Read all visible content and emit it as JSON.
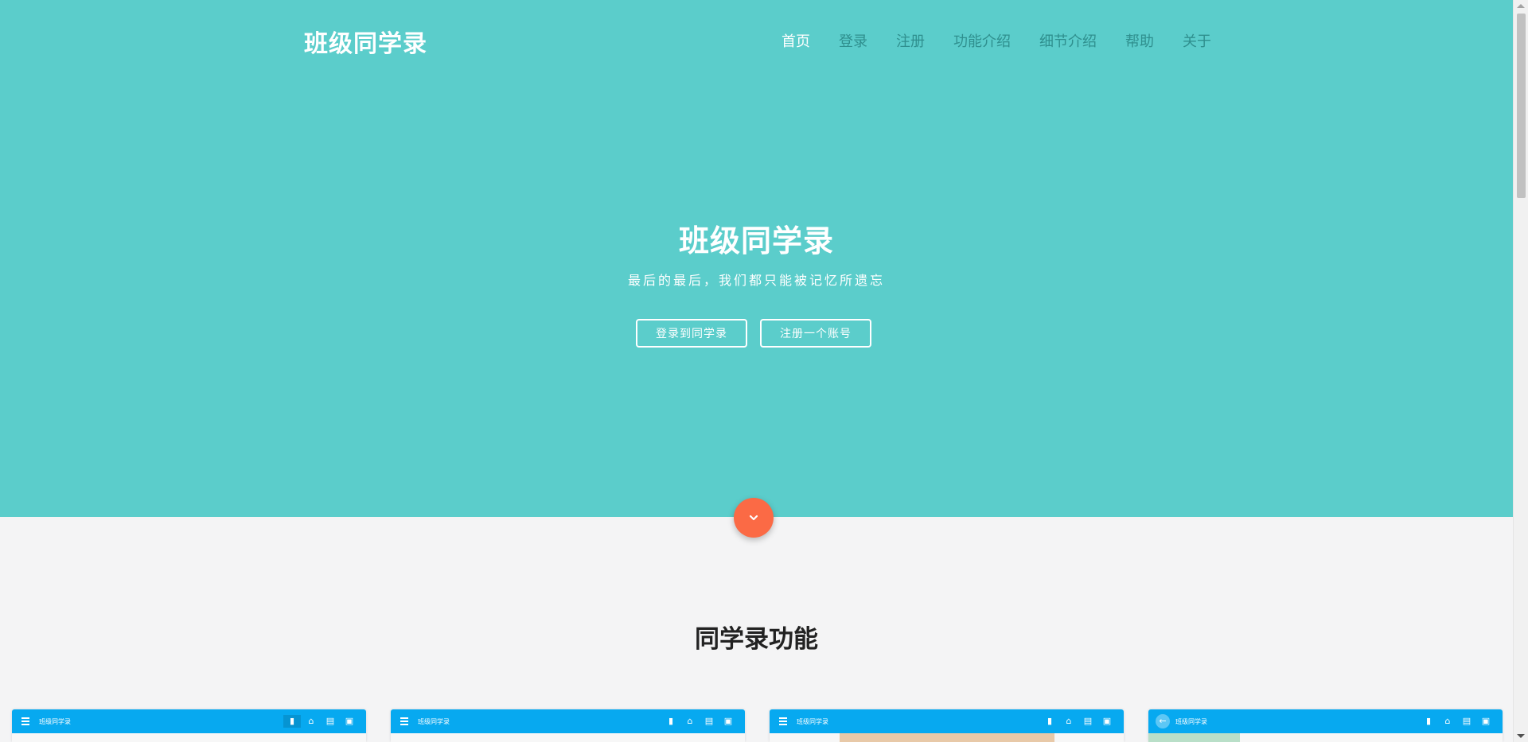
{
  "brand": "班级同学录",
  "nav": [
    {
      "label": "首页",
      "active": true
    },
    {
      "label": "登录",
      "active": false
    },
    {
      "label": "注册",
      "active": false
    },
    {
      "label": "功能介绍",
      "active": false
    },
    {
      "label": "细节介绍",
      "active": false
    },
    {
      "label": "帮助",
      "active": false
    },
    {
      "label": "关于",
      "active": false
    }
  ],
  "hero": {
    "title": "班级同学录",
    "subtitle": "最后的最后，我们都只能被记忆所遗忘",
    "login_button": "登录到同学录",
    "register_button": "注册一个账号"
  },
  "scroll_down_icon": "chevron-down-icon",
  "section": {
    "title": "同学录功能"
  },
  "screenshots": [
    {
      "title": "班级同学录",
      "lead_icon": "menu-icon"
    },
    {
      "title": "班级同学录",
      "lead_icon": "menu-icon"
    },
    {
      "title": "班级同学录",
      "lead_icon": "menu-icon"
    },
    {
      "title": "班级同学录",
      "lead_icon": "back-arrow-icon"
    }
  ],
  "colors": {
    "hero_bg": "#5bcdcb",
    "accent": "#fb6a45",
    "preview_bar": "#07a9f0",
    "section_bg": "#f4f4f5"
  }
}
